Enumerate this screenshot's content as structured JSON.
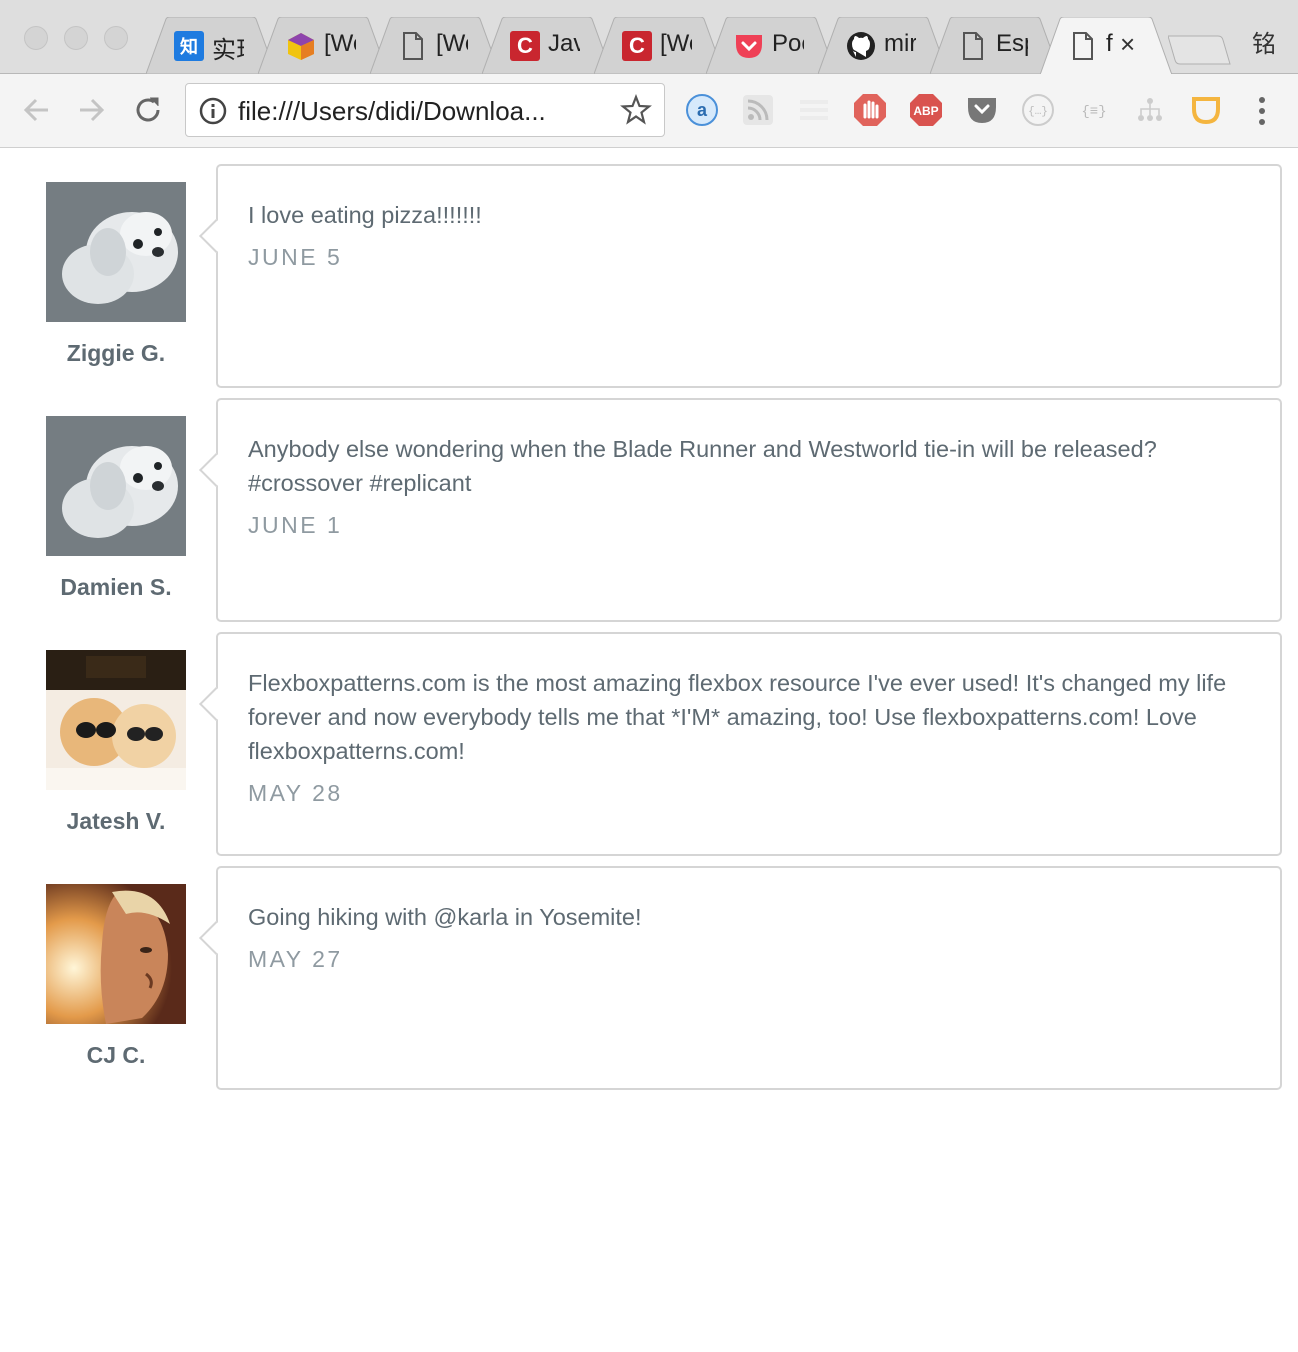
{
  "browser": {
    "profile_label": "铭",
    "url": "file:///Users/didi/Downloa...",
    "tabs": [
      {
        "icon": "zhihu-icon",
        "icon_text": "知",
        "color": "#1e7be0",
        "title": "实现"
      },
      {
        "icon": "mdn-cube-icon",
        "icon_text": "",
        "color": "#9b59b6",
        "title": "[We"
      },
      {
        "icon": "document-icon",
        "icon_text": "",
        "color": "",
        "title": "[We"
      },
      {
        "icon": "csdn-icon",
        "icon_text": "C",
        "color": "#c9262f",
        "title": "Jav"
      },
      {
        "icon": "csdn-icon",
        "icon_text": "C",
        "color": "#c9262f",
        "title": "[We"
      },
      {
        "icon": "pocket-icon",
        "icon_text": "",
        "color": "#ef4056",
        "title": "Poc"
      },
      {
        "icon": "github-icon",
        "icon_text": "",
        "color": "#222222",
        "title": "mir"
      },
      {
        "icon": "document-icon",
        "icon_text": "",
        "color": "",
        "title": "Esp"
      },
      {
        "icon": "document-icon",
        "icon_text": "",
        "color": "",
        "title": "f",
        "active": true
      }
    ]
  },
  "posts": [
    {
      "author": "Ziggie G.",
      "text": "I love eating pizza!!!!!!!",
      "date": "JUNE 5",
      "avatar": "white-dog-avatar"
    },
    {
      "author": "Damien S.",
      "text": "Anybody else wondering when the Blade Runner and Westworld tie-in will be released? #crossover #replicant",
      "date": "JUNE 1",
      "avatar": "white-dog-avatar"
    },
    {
      "author": "Jatesh V.",
      "text": "Flexboxpatterns.com is the most amazing flexbox resource I've ever used! It's changed my life forever and now everybody tells me that *I'M* amazing, too! Use flexboxpatterns.com! Love flexboxpatterns.com!",
      "date": "MAY 28",
      "avatar": "two-dogs-sunglasses-avatar"
    },
    {
      "author": "CJ C.",
      "text": "Going hiking with @karla in Yosemite!",
      "date": "MAY 27",
      "avatar": "man-portrait-avatar"
    }
  ],
  "colors": {
    "text": "#5e6a72",
    "date": "#8f9aa1",
    "border": "#d5d5d5"
  }
}
